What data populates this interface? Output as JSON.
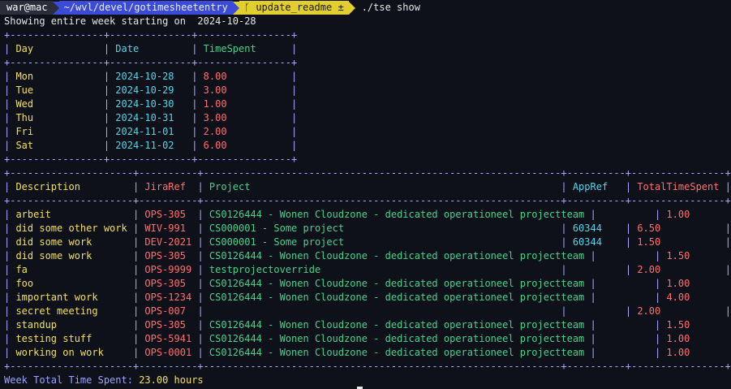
{
  "prompt": {
    "user": "war@mac",
    "path": "~/wvl/devel/gotimesheetentry",
    "git_branch": "update_readme ±",
    "command": "./tse show"
  },
  "header_line": "Showing entire week starting on  2024-10-28",
  "day_table": {
    "border": "+----------------+--------------+----------------+",
    "columns": [
      "Day",
      "Date",
      "TimeSpent"
    ],
    "rows": [
      {
        "day": "Mon",
        "date": "2024-10-28",
        "time": "8.00"
      },
      {
        "day": "Tue",
        "date": "2024-10-29",
        "time": "3.00"
      },
      {
        "day": "Wed",
        "date": "2024-10-30",
        "time": "1.00"
      },
      {
        "day": "Thu",
        "date": "2024-10-31",
        "time": "3.00"
      },
      {
        "day": "Fri",
        "date": "2024-11-01",
        "time": "2.00"
      },
      {
        "day": "Sat",
        "date": "2024-11-02",
        "time": "6.00"
      }
    ]
  },
  "task_table": {
    "border": "+---------------------+----------+-------------------------------------------------------------+----------+----------------+",
    "columns": [
      "Description",
      "JiraRef",
      "Project",
      "AppRef",
      "TotalTimeSpent"
    ],
    "rows": [
      {
        "desc": "arbeit",
        "jira": "OPS-305",
        "project": "CS0126444 - Wonen Cloudzone - dedicated operationeel projectteam",
        "app": "",
        "total": "1.00"
      },
      {
        "desc": "did some other work",
        "jira": "WIV-991",
        "project": "CS000001 - Some project",
        "app": "60344",
        "total": "6.50"
      },
      {
        "desc": "did some work",
        "jira": "DEV-2021",
        "project": "CS000001 - Some project",
        "app": "60344",
        "total": "1.50"
      },
      {
        "desc": "did some work",
        "jira": "OPS-305",
        "project": "CS0126444 - Wonen Cloudzone - dedicated operationeel projectteam",
        "app": "",
        "total": "1.50"
      },
      {
        "desc": "fa",
        "jira": "OPS-9999",
        "project": "testprojectoverride",
        "app": "",
        "total": "2.00"
      },
      {
        "desc": "foo",
        "jira": "OPS-305",
        "project": "CS0126444 - Wonen Cloudzone - dedicated operationeel projectteam",
        "app": "",
        "total": "1.00"
      },
      {
        "desc": "important work",
        "jira": "OPS-1234",
        "project": "CS0126444 - Wonen Cloudzone - dedicated operationeel projectteam",
        "app": "",
        "total": "4.00"
      },
      {
        "desc": "secret meeting",
        "jira": "OPS-007",
        "project": "",
        "app": "",
        "total": "2.00"
      },
      {
        "desc": "standup",
        "jira": "OPS-305",
        "project": "CS0126444 - Wonen Cloudzone - dedicated operationeel projectteam",
        "app": "",
        "total": "1.50"
      },
      {
        "desc": "testing stuff",
        "jira": "OPS-5941",
        "project": "CS0126444 - Wonen Cloudzone - dedicated operationeel projectteam",
        "app": "",
        "total": "1.00"
      },
      {
        "desc": "working on work",
        "jira": "OPS-0001",
        "project": "CS0126444 - Wonen Cloudzone - dedicated operationeel projectteam",
        "app": "",
        "total": "1.00"
      }
    ]
  },
  "summary": {
    "label": "Week Total Time Spent:",
    "value": "23.00 hours"
  },
  "colors": {
    "background": "#0f111a",
    "border": "#a9a8ff",
    "day": "#f1e05a",
    "date": "#4fd6e6",
    "time": "#ff6f6f",
    "description": "#f1e05a",
    "jira": "#ff6f6f",
    "project": "#45d38b",
    "appref": "#4fd6e6",
    "total": "#ff6f6f"
  }
}
